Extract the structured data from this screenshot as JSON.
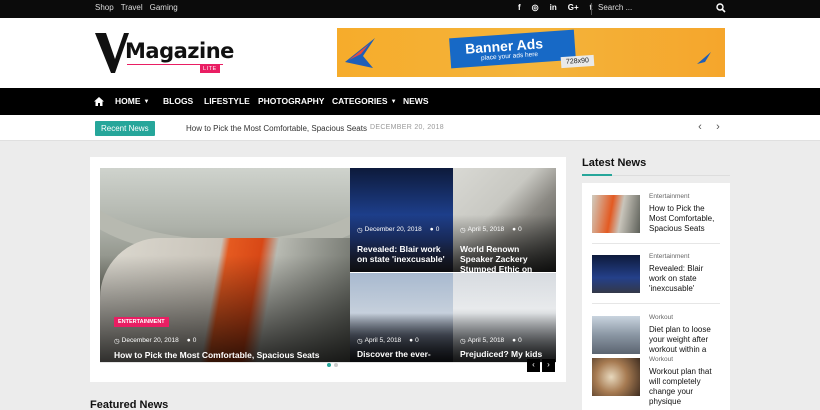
{
  "topbar": {
    "links": [
      "Shop",
      "Travel",
      "Gaming"
    ],
    "socials": [
      {
        "icon": "facebook-icon",
        "glyph": "f"
      },
      {
        "icon": "instagram-icon",
        "glyph": "◎"
      },
      {
        "icon": "linkedin-icon",
        "glyph": "in"
      },
      {
        "icon": "google-plus-icon",
        "glyph": "G+"
      },
      {
        "icon": "tumblr-icon",
        "glyph": "t"
      }
    ],
    "search_placeholder": "Search ..."
  },
  "logo": {
    "text": "Magazine",
    "badge": "LITE"
  },
  "banner": {
    "title": "Banner Ads",
    "subtitle": "place your ads here",
    "size": "728x90"
  },
  "nav": {
    "items": [
      "HOME",
      "BLOGS",
      "LIFESTYLE",
      "PHOTOGRAPHY",
      "CATEGORIES",
      "NEWS"
    ]
  },
  "ticker": {
    "label": "Recent News",
    "title": "How to Pick the Most Comfortable, Spacious Seats",
    "separator": "-",
    "date": "DECEMBER 20, 2018"
  },
  "slider": {
    "big": {
      "category": "ENTERTAINMENT",
      "date": "December 20, 2018",
      "comments": "0",
      "title": "How to Pick the Most Comfortable, Spacious Seats"
    },
    "tiles": [
      {
        "date": "December 20, 2018",
        "comments": "0",
        "title": "Revealed: Blair work on state 'inexcusable'"
      },
      {
        "date": "April 5, 2018",
        "comments": "0",
        "title": "World Renown Speaker Zackery Stumped Ethic on"
      },
      {
        "date": "April 5, 2018",
        "comments": "0",
        "title": "Discover the ever-"
      },
      {
        "date": "April 5, 2018",
        "comments": "0",
        "title": "Prejudiced? My kids are"
      }
    ],
    "prev": "‹",
    "next": "›"
  },
  "sidebar": {
    "heading": "Latest News",
    "items": [
      {
        "category": "Entertainment",
        "title": "How to Pick the Most Comfortable, Spacious Seats"
      },
      {
        "category": "Entertainment",
        "title": "Revealed: Blair work on state 'inexcusable'"
      },
      {
        "category": "Workout",
        "title": "Diet plan to loose your weight after workout within a"
      },
      {
        "category": "Workout",
        "title": "Workout plan that will completely change your physique"
      }
    ]
  },
  "featured": {
    "heading": "Featured News"
  },
  "colors": {
    "accent": "#26a69a",
    "pink": "#e91e63",
    "nav_bg": "#000000",
    "banner": "#f6ac2b"
  }
}
